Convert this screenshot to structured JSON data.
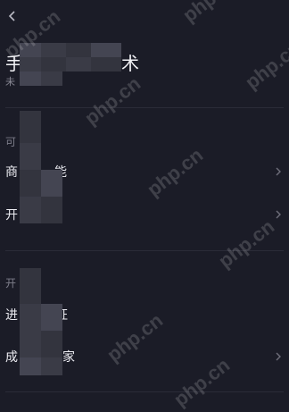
{
  "header": {
    "back_icon": "chevron-left-icon",
    "title_visible": "手",
    "title_tail": "术",
    "subtitle_visible": "未"
  },
  "sections": [
    {
      "label_visible": "可",
      "items": [
        {
          "label_start": "商",
          "label_end": "能"
        },
        {
          "label_start": "开",
          "label_end": ""
        }
      ]
    },
    {
      "label_visible": "开",
      "items": [
        {
          "label_start": "进",
          "label_end": "证"
        },
        {
          "label_start": "成",
          "label_end": "家"
        }
      ]
    }
  ],
  "watermark": {
    "text": "php.cn"
  },
  "colors": {
    "background": "#1b1c27",
    "text": "#ececf2",
    "muted": "#8a8a96",
    "divider": "#2b2c38"
  }
}
